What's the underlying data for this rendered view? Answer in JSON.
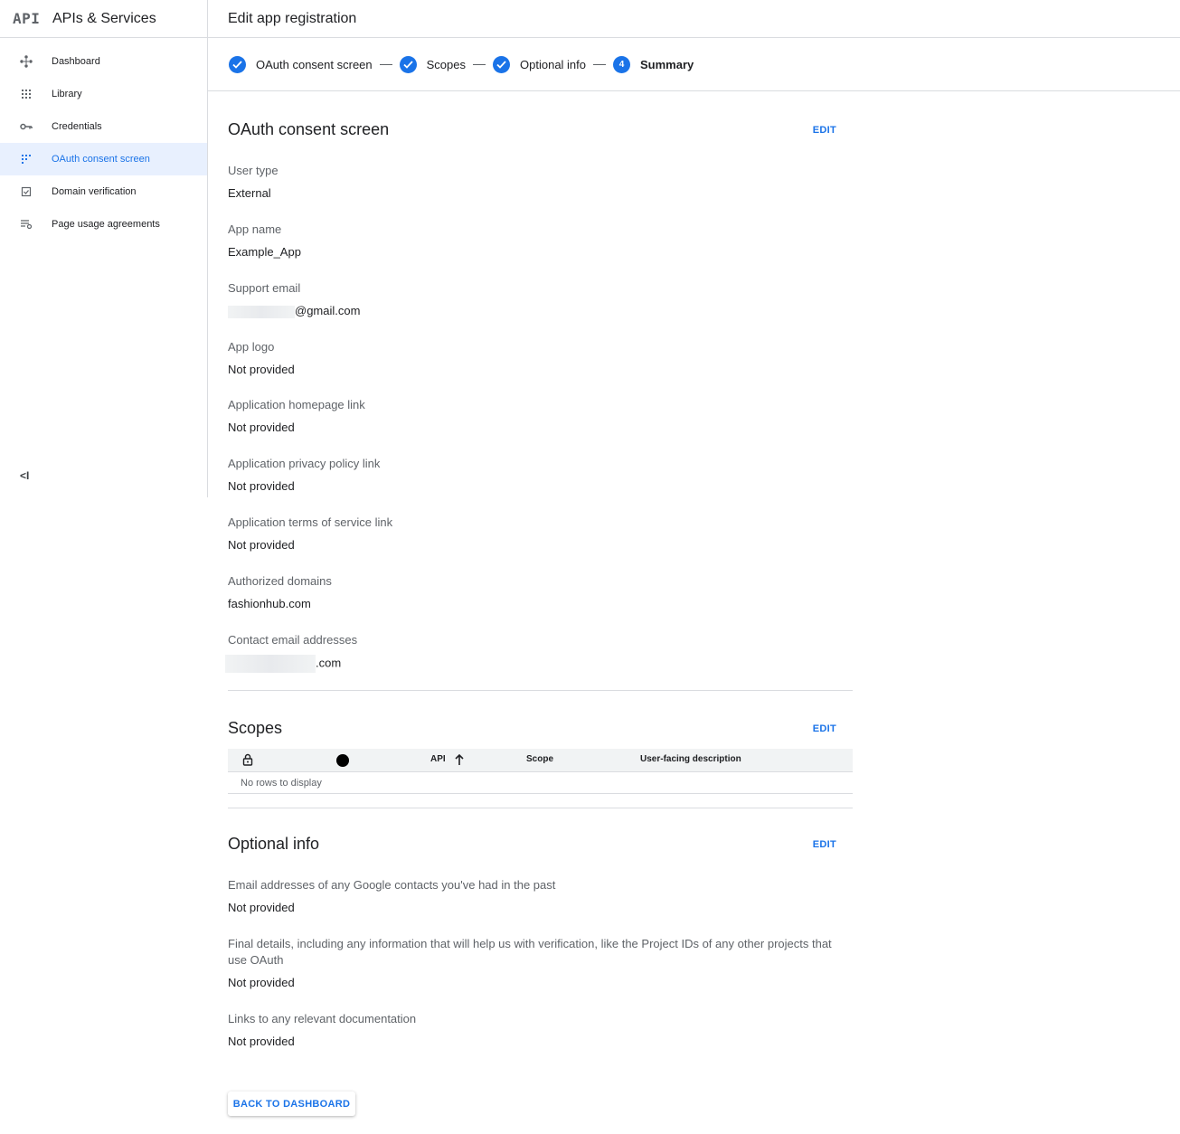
{
  "sidebar": {
    "logo": "API",
    "title": "APIs & Services",
    "items": [
      {
        "label": "Dashboard",
        "icon": "dashboard-icon"
      },
      {
        "label": "Library",
        "icon": "library-icon"
      },
      {
        "label": "Credentials",
        "icon": "key-icon"
      },
      {
        "label": "OAuth consent screen",
        "icon": "oauth-consent-icon",
        "active": true
      },
      {
        "label": "Domain verification",
        "icon": "domain-verification-icon"
      },
      {
        "label": "Page usage agreements",
        "icon": "page-usage-icon"
      }
    ],
    "collapse_label": "<I"
  },
  "header": {
    "title": "Edit app registration"
  },
  "stepper": {
    "steps": [
      {
        "label": "OAuth consent screen",
        "state": "done"
      },
      {
        "label": "Scopes",
        "state": "done"
      },
      {
        "label": "Optional info",
        "state": "done"
      },
      {
        "label": "Summary",
        "state": "current",
        "number": "4"
      }
    ]
  },
  "oauth": {
    "title": "OAuth consent screen",
    "edit": "EDIT",
    "fields": [
      {
        "label": "User type",
        "value": "External"
      },
      {
        "label": "App name",
        "value": "Example_App"
      },
      {
        "label": "Support email",
        "value": "@gmail.com",
        "redacted_prefix": true
      },
      {
        "label": "App logo",
        "value": "Not provided"
      },
      {
        "label": "Application homepage link",
        "value": "Not provided"
      },
      {
        "label": "Application privacy policy link",
        "value": "Not provided"
      },
      {
        "label": "Application terms of service link",
        "value": "Not provided"
      },
      {
        "label": "Authorized domains",
        "value": "fashionhub.com"
      },
      {
        "label": "Contact email addresses",
        "value": ".com",
        "redacted_prefix": true
      }
    ]
  },
  "scopes": {
    "title": "Scopes",
    "edit": "EDIT",
    "columns": {
      "api": "API",
      "scope": "Scope",
      "description": "User-facing description"
    },
    "empty": "No rows to display"
  },
  "optional": {
    "title": "Optional info",
    "edit": "EDIT",
    "fields": [
      {
        "label": "Email addresses of any Google contacts you've had in the past",
        "value": "Not provided"
      },
      {
        "label": "Final details, including any information that will help us with verification, like the Project IDs of any other projects that use OAuth",
        "value": "Not provided"
      },
      {
        "label": "Links to any relevant documentation",
        "value": "Not provided"
      }
    ]
  },
  "footer": {
    "back_button": "BACK TO DASHBOARD"
  },
  "colors": {
    "accent": "#1a73e8",
    "active_bg": "#e8f0fe",
    "divider": "#dadce0"
  }
}
